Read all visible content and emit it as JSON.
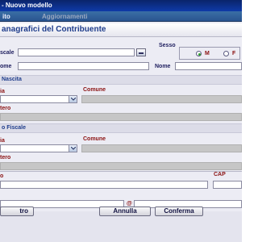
{
  "window": {
    "title": "- Nuovo modello"
  },
  "menu": {
    "item1": "ito",
    "item2": "Aggiornamenti"
  },
  "heading": "anagrafici del Contribuente",
  "fields": {
    "fiscale_label": "scale",
    "sesso_label": "Sesso",
    "sesso_m": "M",
    "sesso_f": "F",
    "nome_left_label": "ome",
    "nome_label": "Nome"
  },
  "nascita": {
    "section": "Nascita",
    "provincia_label": "ia",
    "comune_label": "Comune",
    "estero_label": "tero"
  },
  "domicilio": {
    "section": "o Fiscale",
    "provincia_label": "ia",
    "comune_label": "Comune",
    "estero_label": "tero"
  },
  "indirizzo": {
    "label": "o",
    "cap_label": "CAP"
  },
  "contatti": {
    "email_symbol": "@"
  },
  "buttons": {
    "left": "tro",
    "cancel": "Annulla",
    "confirm": "Conferma"
  },
  "icons": {
    "calendar": "calendar-icon",
    "dropdown": "chevron-down-icon"
  },
  "colors": {
    "titlebar": "#0a246a",
    "heading": "#1f3d8c",
    "label_red": "#8a1010",
    "radio_selected": "#2a9a2a"
  }
}
